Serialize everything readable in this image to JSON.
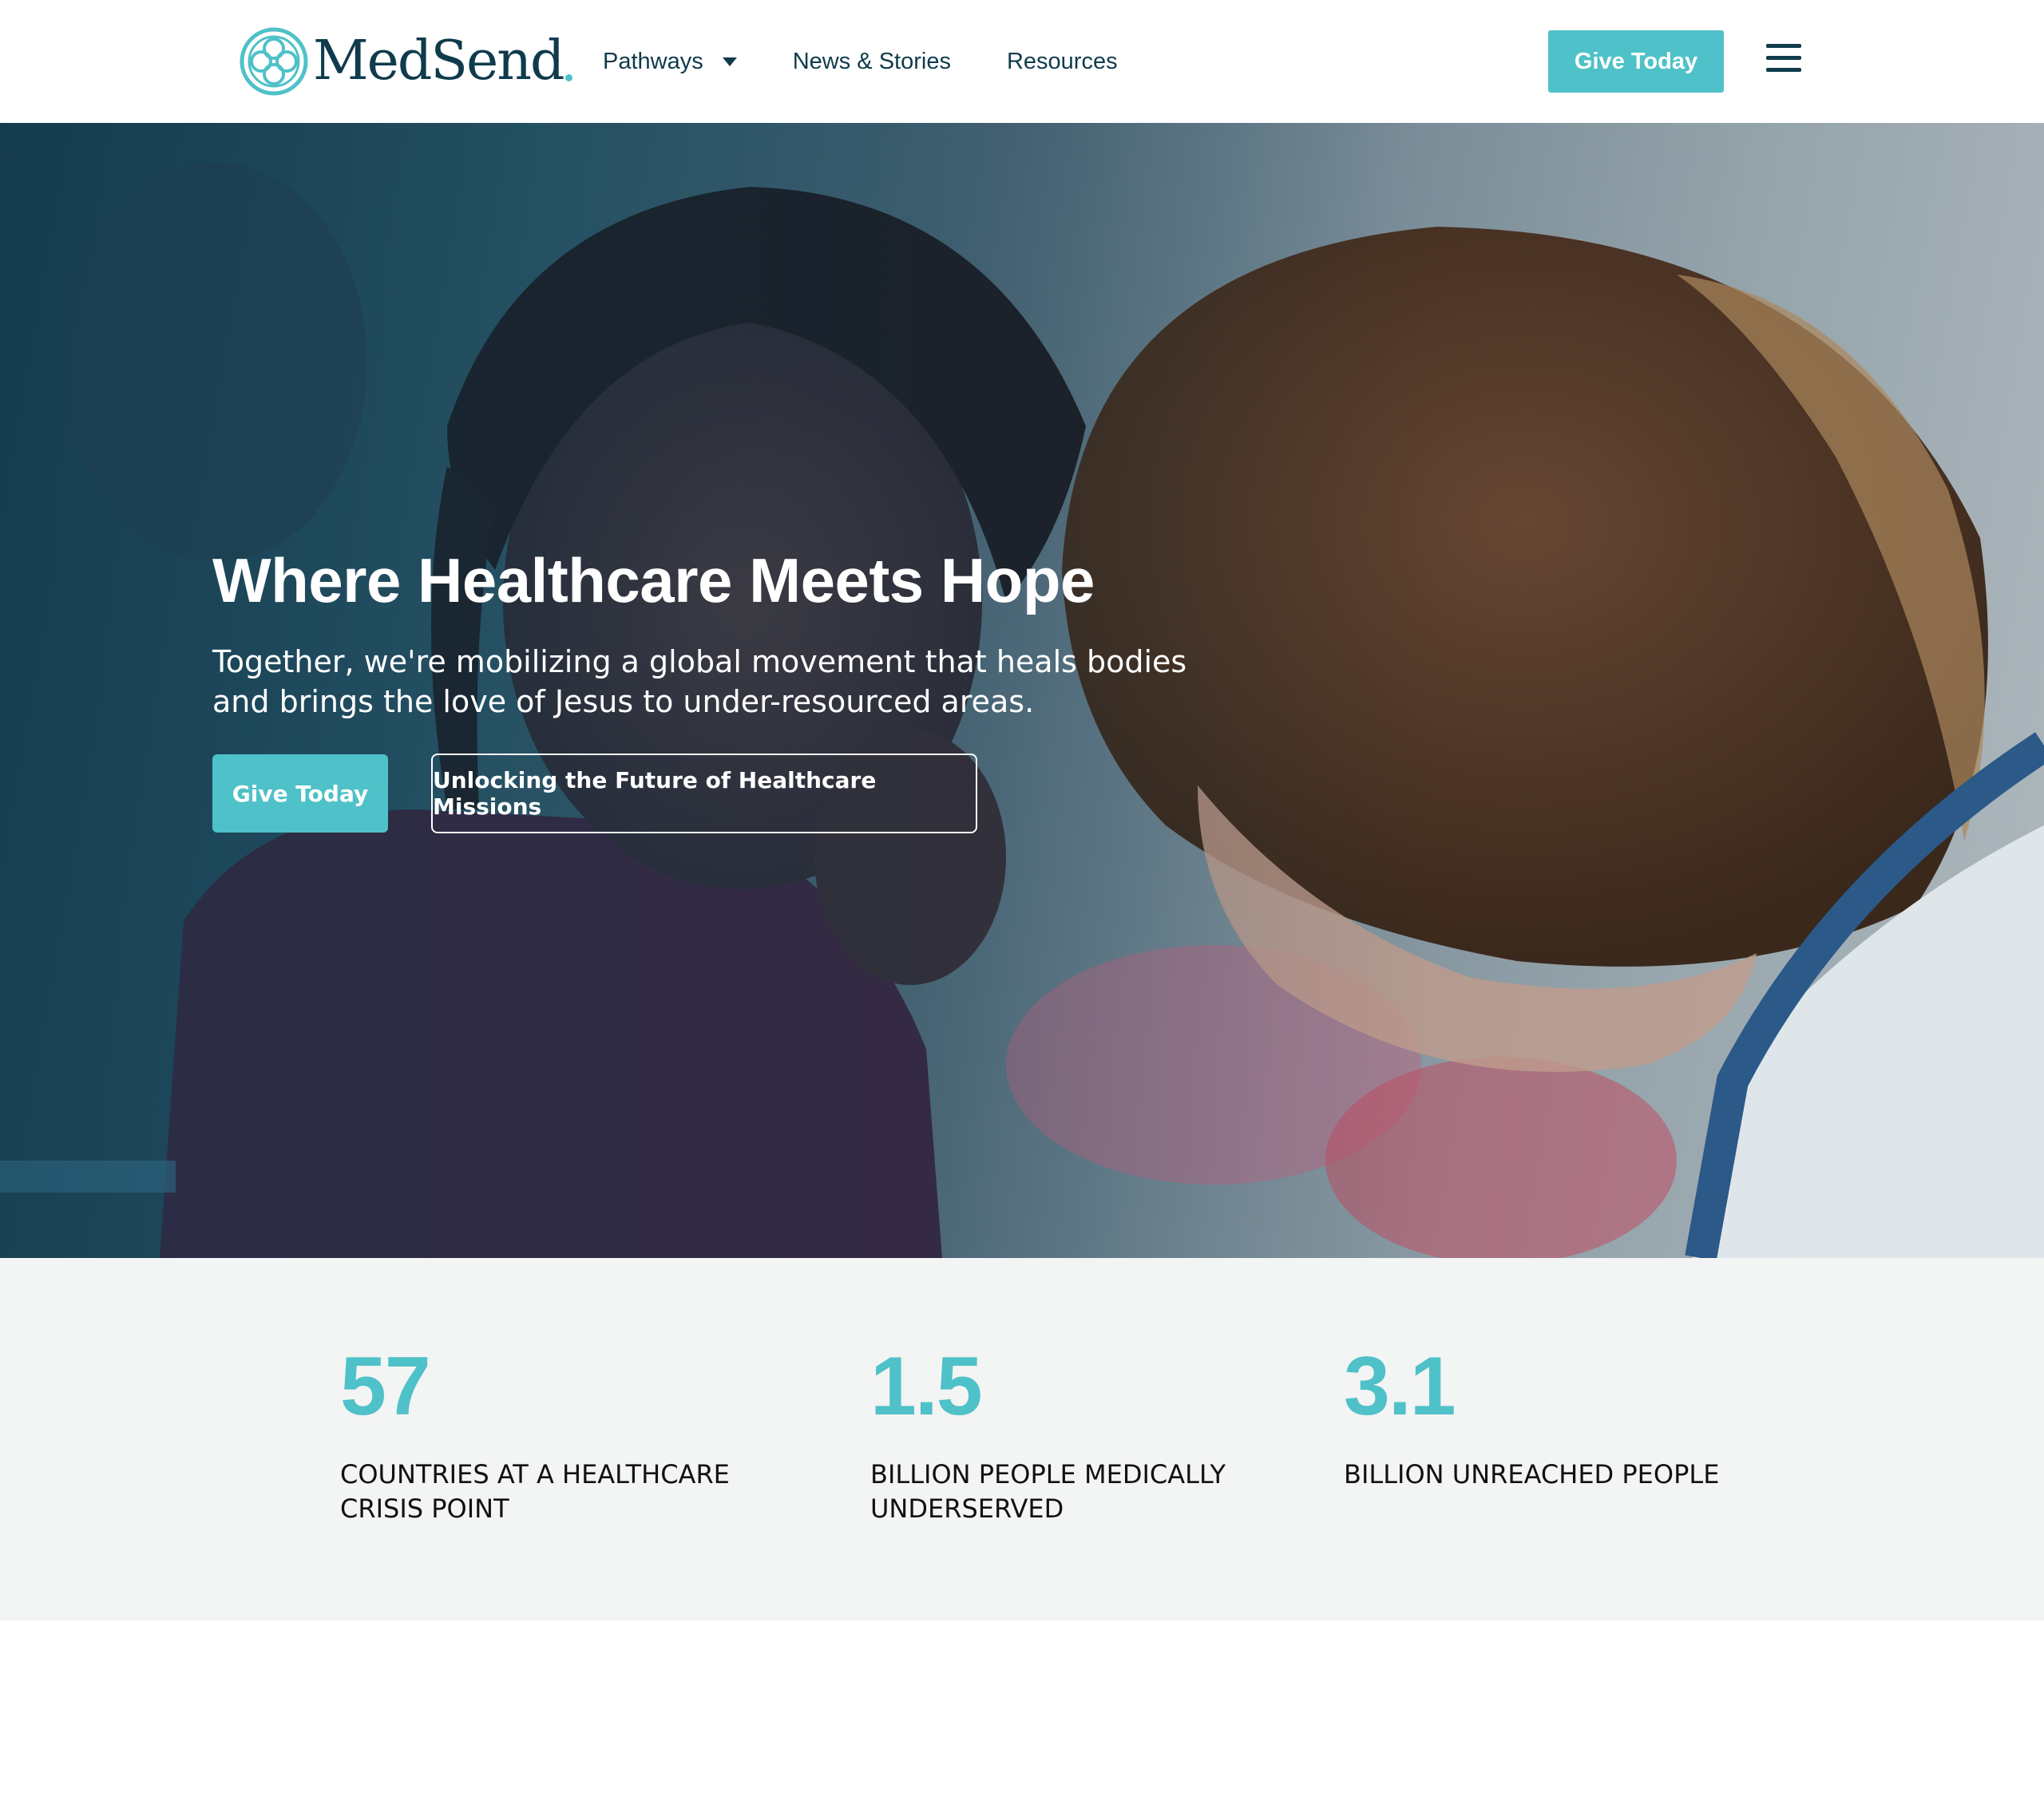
{
  "header": {
    "logo_text": "MedSend",
    "nav": [
      {
        "label": "Pathways",
        "has_dropdown": true
      },
      {
        "label": "News & Stories"
      },
      {
        "label": "Resources"
      }
    ],
    "give_button": "Give Today"
  },
  "hero": {
    "title": "Where Healthcare Meets Hope",
    "subtitle": "Together, we're mobilizing a global movement that heals bodies and brings the love of Jesus to under-resourced areas.",
    "primary_button": "Give Today",
    "secondary_button": "Unlocking the Future of Healthcare Missions"
  },
  "stats": [
    {
      "number": "57",
      "label": "COUNTRIES AT A HEALTHCARE CRISIS POINT"
    },
    {
      "number": "1.5",
      "label": "BILLION PEOPLE MEDICALLY UNDERSERVED"
    },
    {
      "number": "3.1",
      "label": "BILLION UNREACHED PEOPLE"
    }
  ],
  "colors": {
    "brand_teal": "#4fc1c8",
    "navy": "#0f3b4c",
    "stats_bg": "#f3f4f4"
  },
  "icons": [
    "medsend-logo-icon",
    "chevron-down-icon",
    "hamburger-menu-icon"
  ]
}
